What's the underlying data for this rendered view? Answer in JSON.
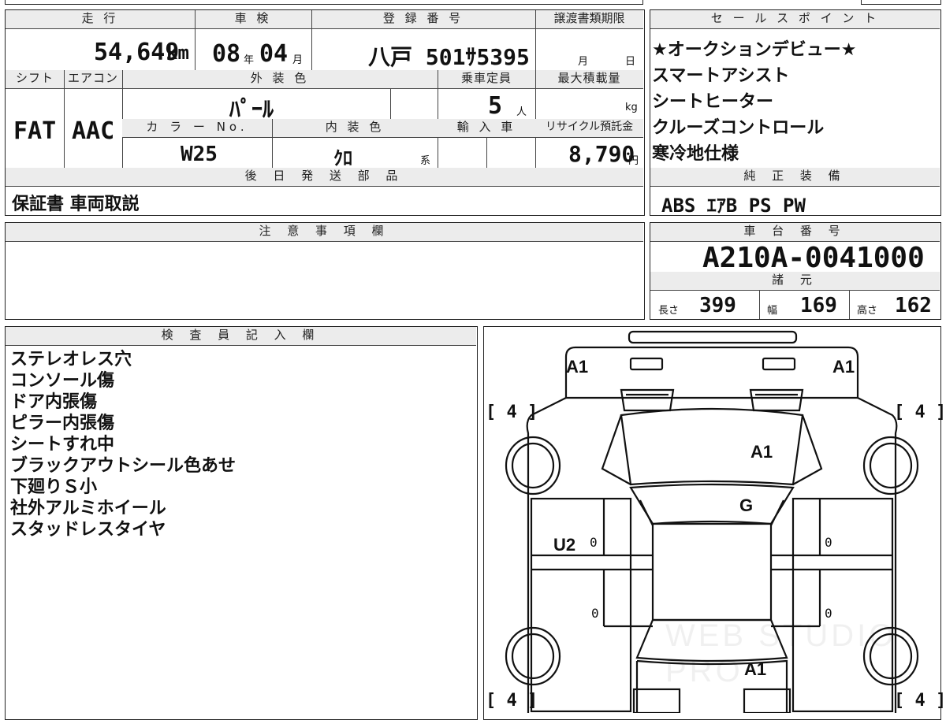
{
  "headers": {
    "mileage": "走 行",
    "inspection": "車 検",
    "registration": "登 録 番 号",
    "transfer_deadline": "譲渡書類期限",
    "shift": "シフト",
    "aircon": "エアコン",
    "exterior_color": "外 装 色",
    "capacity": "乗車定員",
    "max_load": "最大積載量",
    "color_no": "カ ラ ー No.",
    "interior_color": "内 装 色",
    "import": "輸 入 車",
    "recycle": "リサイクル預託金",
    "later_parts": "後 日 発 送 部 品",
    "notes": "注 意 事 項 欄",
    "selling_points": "セ ー ル ス ポ イ ン ト",
    "equipment": "純 正 装 備",
    "chassis": "車 台 番 号",
    "specs": "諸 元",
    "inspector": "検 査 員 記 入 欄"
  },
  "values": {
    "mileage": "54,649",
    "mileage_unit": "km",
    "inspection_year": "08",
    "year_unit": "年",
    "inspection_month": "04",
    "month_unit": "月",
    "registration_plate": "八戸 501ｻ5395",
    "deadline_month_label": "月",
    "deadline_day_label": "日",
    "shift": "FAT",
    "aircon": "AAC",
    "exterior_color": "ﾊﾟｰﾙ",
    "capacity": "5",
    "capacity_unit": "人",
    "load_unit": "kg",
    "color_no": "W25",
    "interior_color": "ｸﾛ",
    "interior_suffix": "系",
    "recycle_fee": "8,790",
    "recycle_unit": "円",
    "later_parts": "保証書 車両取説",
    "chassis_number": "A210A-0041000",
    "length_label": "長さ",
    "length": "399",
    "width_label": "幅",
    "width": "169",
    "height_label": "高さ",
    "height": "162",
    "equipment": "ABS ｴｱB PS PW"
  },
  "selling_points": [
    "★オークションデビュー★",
    "スマートアシスト",
    "シートヒーター",
    "クルーズコントロール",
    "寒冷地仕様"
  ],
  "inspector_notes": [
    "ステレオレス穴",
    "コンソール傷",
    "ドア内張傷",
    "ピラー内張傷",
    "シートすれ中",
    "ブラックアウトシール色あせ",
    "下廻りＳ小",
    "社外アルミホイール",
    "スタッドレスタイヤ"
  ],
  "diagram": {
    "front_left": "A1",
    "front_right": "A1",
    "hood": "A1",
    "windshield": "G",
    "left_front_door": "U2",
    "left_front_door_zero": "0",
    "left_rear_door_zero": "0",
    "right_front_door_zero": "0",
    "right_rear_door_zero": "0",
    "roof_rear": "A1",
    "tire_front_left": "[ 4 ]",
    "tire_front_right": "[ 4 ]",
    "tire_rear_left": "[ 4 ]",
    "tire_rear_right": "[ 4 ]",
    "watermark": "WEB STUDIO PRO"
  }
}
